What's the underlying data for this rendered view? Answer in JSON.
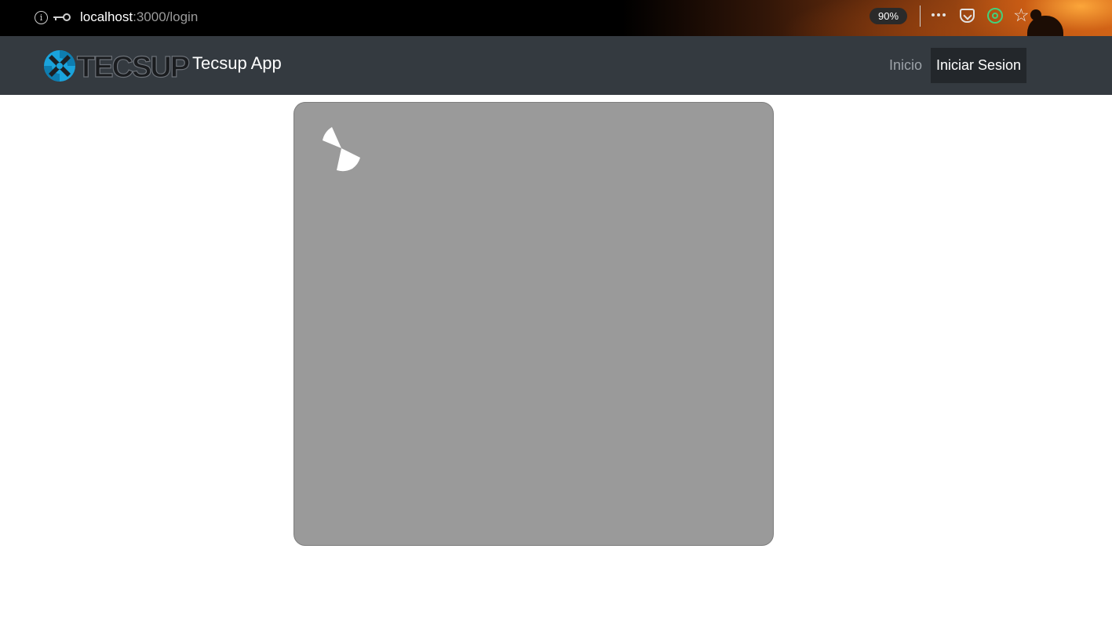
{
  "browser": {
    "url_host": "localhost",
    "url_path": ":3000/login",
    "zoom": "90%",
    "icons": [
      "info-icon",
      "key-icon",
      "more-options-icon",
      "pocket-icon",
      "extension-target-icon",
      "bookmark-star-icon"
    ]
  },
  "navbar": {
    "logo_text": "TECSUP",
    "brand": "Tecsup App",
    "links": [
      {
        "label": "Inicio",
        "active": false
      },
      {
        "label": "Iniciar Sesion",
        "active": true
      }
    ],
    "colors": {
      "background": "#343a40",
      "active_link_bg": "#23272b",
      "link_muted": "#9da3a9",
      "logo_blue": "#1aa3dc"
    }
  },
  "card": {
    "state": "loading",
    "icon": "loading-spinner-icon",
    "background": "#9a9a9a"
  }
}
